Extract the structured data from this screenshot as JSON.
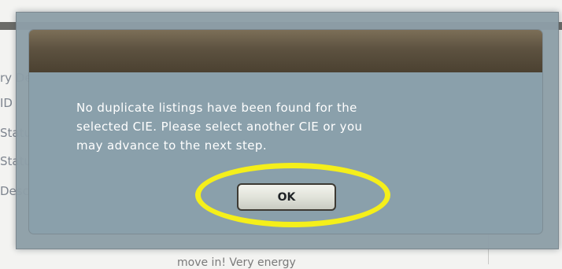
{
  "background": {
    "rows": [
      "ry Details",
      "ID",
      "Status",
      "Status",
      "Description"
    ],
    "bottom_text": "move in! Very energy"
  },
  "dialog": {
    "message_lines": [
      "No duplicate listings have been found for the",
      "selected CIE. Please select another CIE or you",
      "may advance to the next step."
    ],
    "ok_label": "OK"
  },
  "colors": {
    "header": "#5d5240",
    "dialog_body": "#8aa0ab",
    "highlight": "#f5ef1a"
  }
}
